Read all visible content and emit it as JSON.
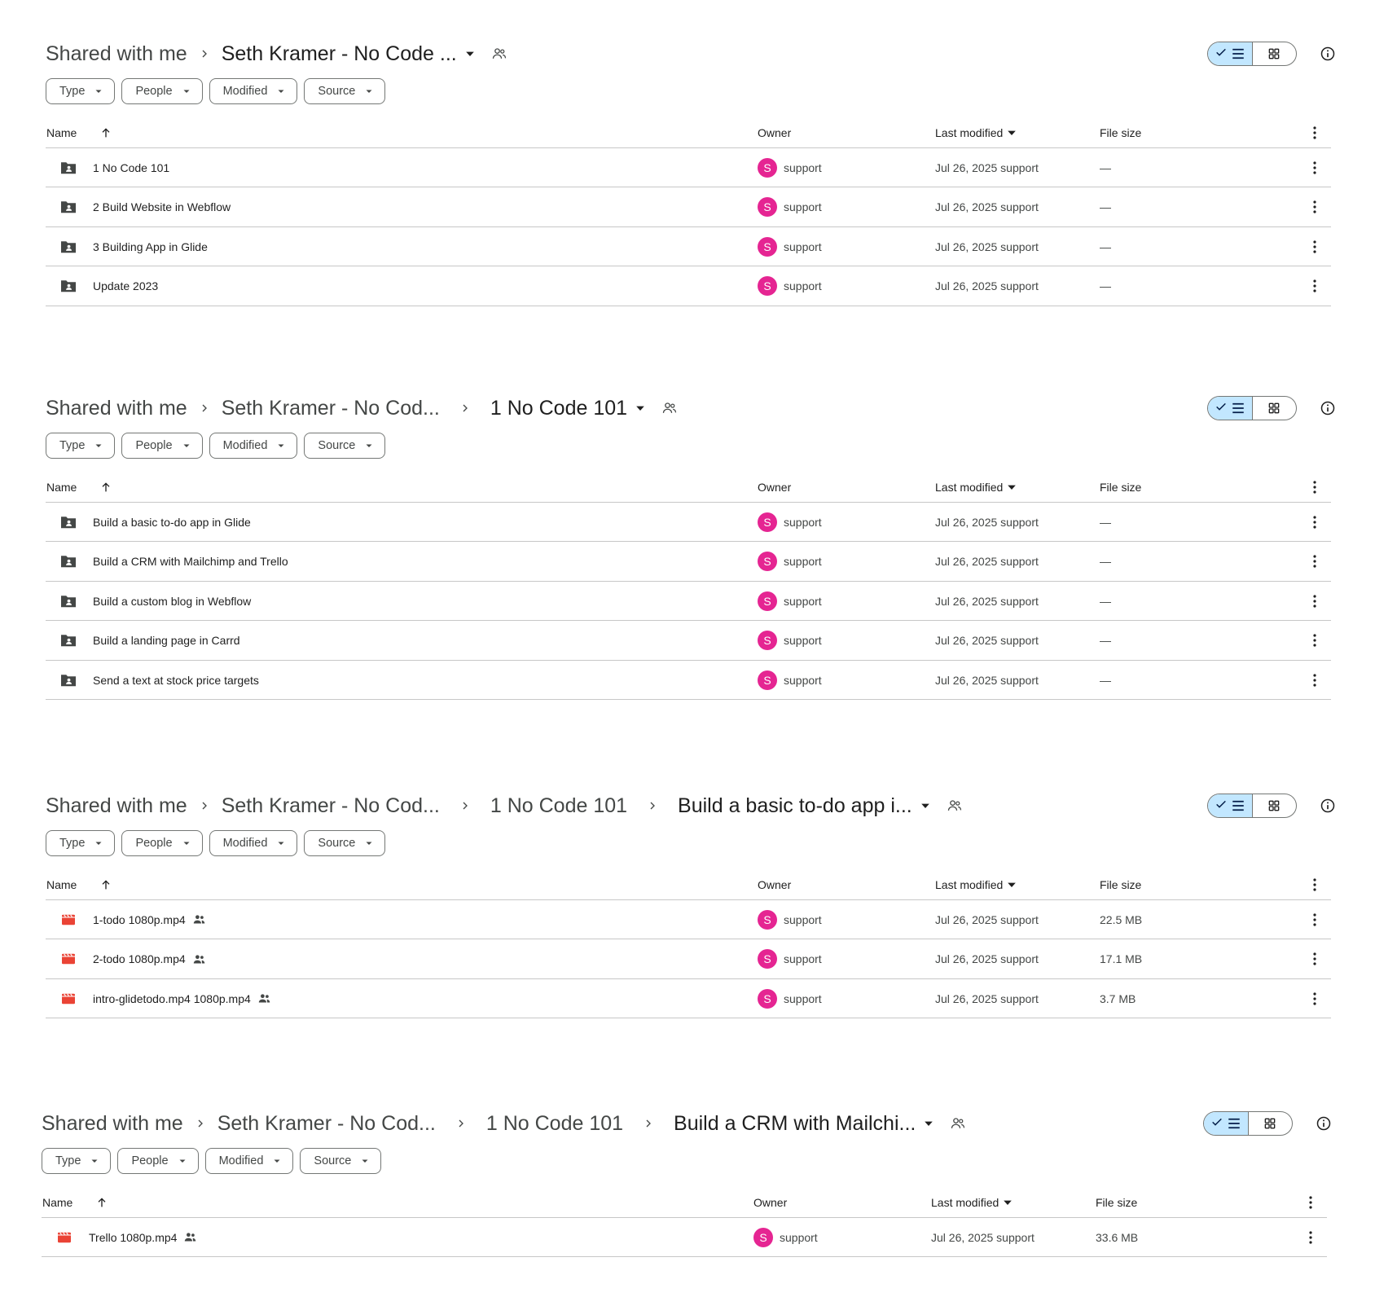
{
  "colors": {
    "accent_toggle": "#c2e7ff",
    "avatar": "#e52592",
    "video_icon": "#ea4335",
    "folder_icon": "#444746"
  },
  "filters": [
    "Type",
    "People",
    "Modified",
    "Source"
  ],
  "columns": {
    "name": "Name",
    "owner": "Owner",
    "modified": "Last modified",
    "size": "File size"
  },
  "panels": [
    {
      "crumbs": [
        "Shared with me",
        "Seth Kramer - No Code ..."
      ],
      "rows": [
        {
          "icon": "shared-folder-icon",
          "name": "1 No Code 101",
          "shared": false,
          "owner_initial": "S",
          "owner": "support",
          "modified": "Jul 26, 2025 support",
          "size": "—"
        },
        {
          "icon": "shared-folder-icon",
          "name": "2 Build Website in Webflow",
          "shared": false,
          "owner_initial": "S",
          "owner": "support",
          "modified": "Jul 26, 2025 support",
          "size": "—"
        },
        {
          "icon": "shared-folder-icon",
          "name": "3 Building App in Glide",
          "shared": false,
          "owner_initial": "S",
          "owner": "support",
          "modified": "Jul 26, 2025 support",
          "size": "—"
        },
        {
          "icon": "shared-folder-icon",
          "name": "Update 2023",
          "shared": false,
          "owner_initial": "S",
          "owner": "support",
          "modified": "Jul 26, 2025 support",
          "size": "—"
        }
      ]
    },
    {
      "crumbs": [
        "Shared with me",
        "Seth Kramer - No Cod...",
        "1 No Code 101"
      ],
      "rows": [
        {
          "icon": "shared-folder-icon",
          "name": "Build a basic to-do app in Glide",
          "shared": false,
          "owner_initial": "S",
          "owner": "support",
          "modified": "Jul 26, 2025 support",
          "size": "—"
        },
        {
          "icon": "shared-folder-icon",
          "name": "Build a CRM with Mailchimp and Trello",
          "shared": false,
          "owner_initial": "S",
          "owner": "support",
          "modified": "Jul 26, 2025 support",
          "size": "—"
        },
        {
          "icon": "shared-folder-icon",
          "name": "Build a custom blog in Webflow",
          "shared": false,
          "owner_initial": "S",
          "owner": "support",
          "modified": "Jul 26, 2025 support",
          "size": "—"
        },
        {
          "icon": "shared-folder-icon",
          "name": "Build a landing page in Carrd",
          "shared": false,
          "owner_initial": "S",
          "owner": "support",
          "modified": "Jul 26, 2025 support",
          "size": "—"
        },
        {
          "icon": "shared-folder-icon",
          "name": "Send a text at stock price targets",
          "shared": false,
          "owner_initial": "S",
          "owner": "support",
          "modified": "Jul 26, 2025 support",
          "size": "—"
        }
      ]
    },
    {
      "crumbs": [
        "Shared with me",
        "Seth Kramer - No Cod...",
        "1 No Code 101",
        "Build a basic to-do app i..."
      ],
      "rows": [
        {
          "icon": "video-file-icon",
          "name": "1-todo 1080p.mp4",
          "shared": true,
          "owner_initial": "S",
          "owner": "support",
          "modified": "Jul 26, 2025 support",
          "size": "22.5 MB"
        },
        {
          "icon": "video-file-icon",
          "name": "2-todo 1080p.mp4",
          "shared": true,
          "owner_initial": "S",
          "owner": "support",
          "modified": "Jul 26, 2025 support",
          "size": "17.1 MB"
        },
        {
          "icon": "video-file-icon",
          "name": "intro-glidetodo.mp4 1080p.mp4",
          "shared": true,
          "owner_initial": "S",
          "owner": "support",
          "modified": "Jul 26, 2025 support",
          "size": "3.7 MB"
        }
      ]
    },
    {
      "crumbs": [
        "Shared with me",
        "Seth Kramer - No Cod...",
        "1 No Code 101",
        "Build a CRM with Mailchi..."
      ],
      "rows": [
        {
          "icon": "video-file-icon",
          "name": "Trello 1080p.mp4",
          "shared": true,
          "owner_initial": "S",
          "owner": "support",
          "modified": "Jul 26, 2025 support",
          "size": "33.6 MB"
        }
      ]
    }
  ]
}
